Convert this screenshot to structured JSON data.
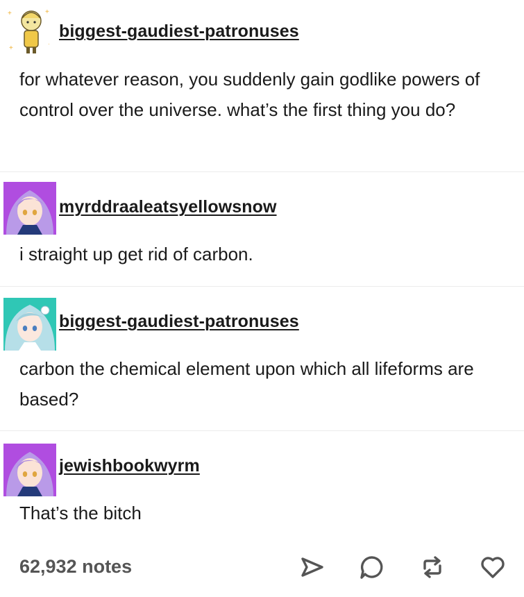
{
  "posts": [
    {
      "username": "biggest-gaudiest-patronuses",
      "avatar_icon": "chibi-character-avatar-icon",
      "text": "for whatever reason, you suddenly gain godlike powers of control over the universe. what’s the first thing you do?"
    },
    {
      "username": "myrddraaleatsyellowsnow",
      "avatar_icon": "purple-hair-anime-avatar-icon",
      "text": "i straight up get rid of carbon."
    },
    {
      "username": "biggest-gaudiest-patronuses",
      "avatar_icon": "teal-hair-anime-avatar-icon",
      "text": "carbon the chemical element upon which all lifeforms are based?"
    },
    {
      "username": "jewishbookwyrm",
      "avatar_icon": "purple-hair-anime-avatar-icon",
      "text": "That’s the bitch"
    }
  ],
  "footer": {
    "notes": "62,932 notes",
    "actions": [
      "share-icon",
      "reply-icon",
      "reblog-icon",
      "like-icon"
    ]
  },
  "colors": {
    "text": "#1a1a1a",
    "notes": "#555555",
    "divider": "#ececec",
    "avatar_purple_bg": "#b04de0",
    "avatar_teal_bg": "#2fc7b5"
  }
}
